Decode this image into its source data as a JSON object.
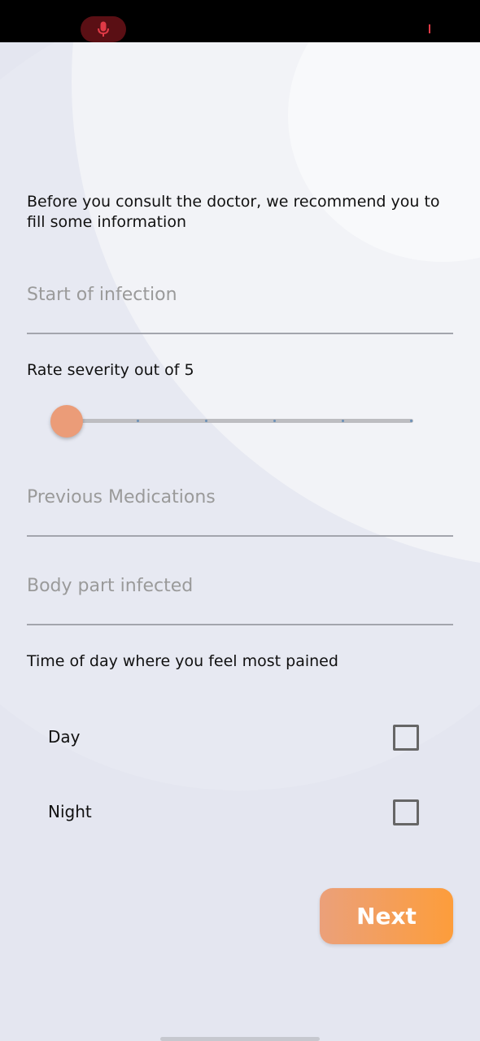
{
  "status_bar": {
    "mic_icon": "microphone-icon",
    "mic_color": "#e03a46"
  },
  "form": {
    "intro": "Before you consult the doctor, we recommend you to fill some information",
    "start_of_infection_placeholder": "Start of infection",
    "severity_label": "Rate severity out of 5",
    "severity_value": 0,
    "severity_max": 5,
    "previous_medications_placeholder": "Previous Medications",
    "body_part_placeholder": "Body part infected",
    "time_of_day_label": "Time of day where you feel most pained",
    "options": [
      {
        "label": "Day",
        "checked": false
      },
      {
        "label": "Night",
        "checked": false
      }
    ],
    "next_label": "Next"
  },
  "colors": {
    "accent_start": "#eba07a",
    "accent_end": "#fd9d3b",
    "slider_thumb": "#eb9c78"
  }
}
